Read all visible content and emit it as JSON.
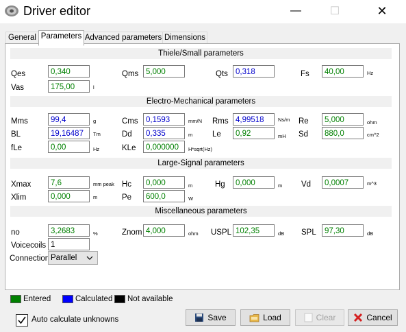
{
  "window": {
    "title": "Driver editor",
    "minimize_glyph": "—",
    "maximize_glyph": "☐",
    "close_glyph": "✕"
  },
  "tabs": [
    "General",
    "Parameters",
    "Advanced parameters",
    "Dimensions"
  ],
  "sections": {
    "ts": "Thiele/Small parameters",
    "em": "Electro-Mechanical parameters",
    "ls": "Large-Signal parameters",
    "misc": "Miscellaneous parameters"
  },
  "params": {
    "qes": {
      "label": "Qes",
      "value": "0,340",
      "unit": ""
    },
    "qms": {
      "label": "Qms",
      "value": "5,000",
      "unit": ""
    },
    "qts": {
      "label": "Qts",
      "value": "0,318",
      "unit": ""
    },
    "fs": {
      "label": "Fs",
      "value": "40,00",
      "unit": "Hz"
    },
    "vas": {
      "label": "Vas",
      "value": "175,00",
      "unit": "l"
    },
    "mms": {
      "label": "Mms",
      "value": "99,4",
      "unit": "g"
    },
    "cms": {
      "label": "Cms",
      "value": "0,1593",
      "unit": "mm/N"
    },
    "rms": {
      "label": "Rms",
      "value": "4,99518",
      "unit": "Ns/m"
    },
    "re": {
      "label": "Re",
      "value": "5,000",
      "unit": "ohm"
    },
    "bl": {
      "label": "BL",
      "value": "19,16487",
      "unit": "Tm"
    },
    "dd": {
      "label": "Dd",
      "value": "0,335",
      "unit": "m"
    },
    "le": {
      "label": "Le",
      "value": "0,92",
      "unit": "mH"
    },
    "sd": {
      "label": "Sd",
      "value": "880,0",
      "unit": "cm^2"
    },
    "fle": {
      "label": "fLe",
      "value": "0,00",
      "unit": "Hz"
    },
    "kle": {
      "label": "KLe",
      "value": "0,000000",
      "unit": "H*sqrt(Hz)"
    },
    "xmax": {
      "label": "Xmax",
      "value": "7,6",
      "unit": "mm  peak"
    },
    "hc": {
      "label": "Hc",
      "value": "0,000",
      "unit": "m"
    },
    "hg": {
      "label": "Hg",
      "value": "0,000",
      "unit": "m"
    },
    "vd": {
      "label": "Vd",
      "value": "0,0007",
      "unit": "m^3"
    },
    "xlim": {
      "label": "Xlim",
      "value": "0,000",
      "unit": "m"
    },
    "pe": {
      "label": "Pe",
      "value": "600,0",
      "unit": "W"
    },
    "no": {
      "label": "no",
      "value": "3,2683",
      "unit": "%"
    },
    "znom": {
      "label": "Znom",
      "value": "4,000",
      "unit": "ohm"
    },
    "uspl": {
      "label": "USPL",
      "value": "102,35",
      "unit": "dB"
    },
    "spl": {
      "label": "SPL",
      "value": "97,30",
      "unit": "dB"
    },
    "voicecoils": {
      "label": "Voicecoils",
      "value": "1"
    },
    "connection": {
      "label": "Connection",
      "value": "Parallel"
    }
  },
  "legend": {
    "entered": "Entered",
    "calculated": "Calculated",
    "not_available": "Not available"
  },
  "colors": {
    "entered": "#008000",
    "calculated": "#0000ff",
    "not_available": "#000000"
  },
  "auto_calc": {
    "label": "Auto calculate unknowns",
    "checked": true
  },
  "buttons": {
    "save": "Save",
    "load": "Load",
    "clear": "Clear",
    "cancel": "Cancel"
  }
}
